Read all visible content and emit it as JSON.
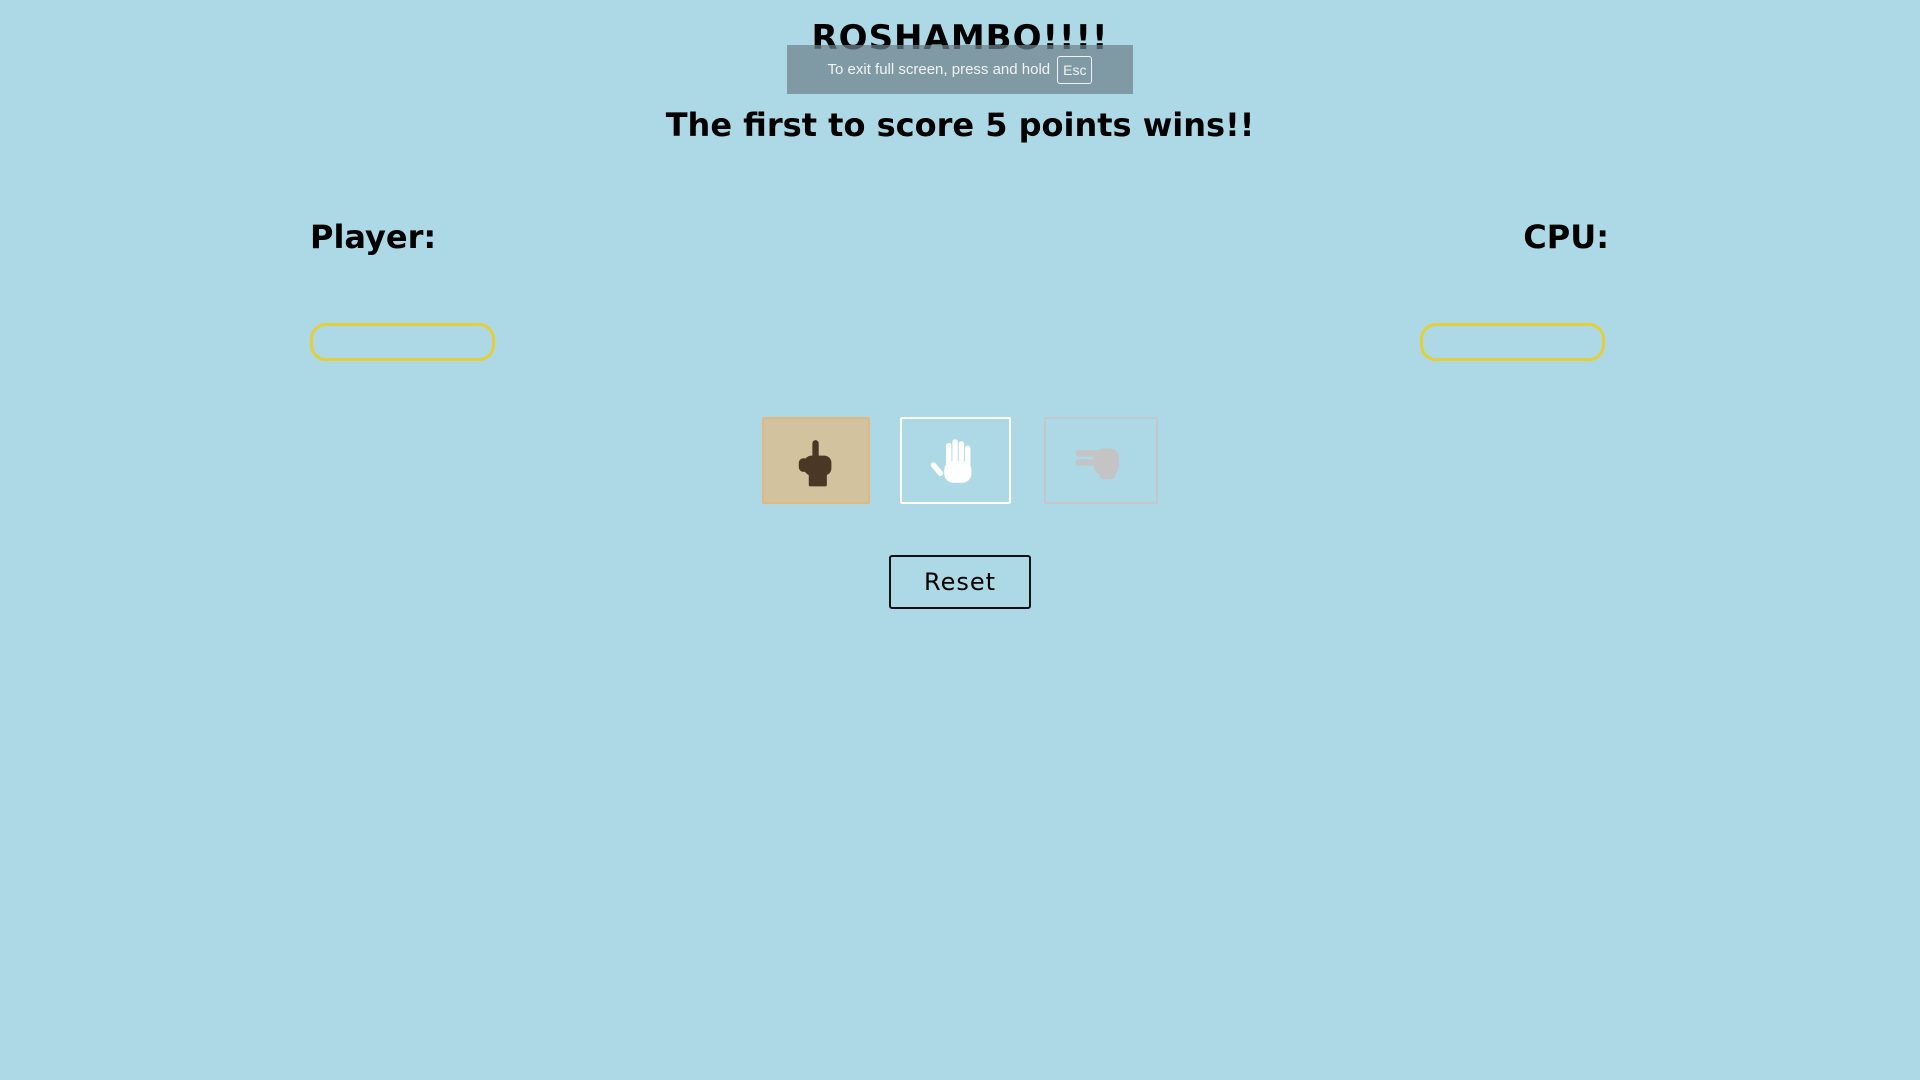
{
  "header": {
    "title": "ROSHAMBO!!!!",
    "subtitle": "The first to score 5 points wins!!"
  },
  "fullscreen_notice": {
    "text": "To exit full screen, press and hold",
    "key": "Esc"
  },
  "scoreboard": {
    "player_label": "Player:",
    "cpu_label": "CPU:",
    "player_score": "",
    "cpu_score": ""
  },
  "choices": [
    {
      "name": "rock",
      "icon": "fist-icon",
      "color": "#4a3826"
    },
    {
      "name": "paper",
      "icon": "open-hand-icon",
      "color": "#ffffff"
    },
    {
      "name": "scissors",
      "icon": "scissors-hand-icon",
      "color": "#c4c4c4"
    }
  ],
  "controls": {
    "reset_label": "Reset"
  },
  "colors": {
    "background": "#add8e6",
    "score_box_border": "#e2cf3a",
    "rock_background": "#d2c29e"
  }
}
